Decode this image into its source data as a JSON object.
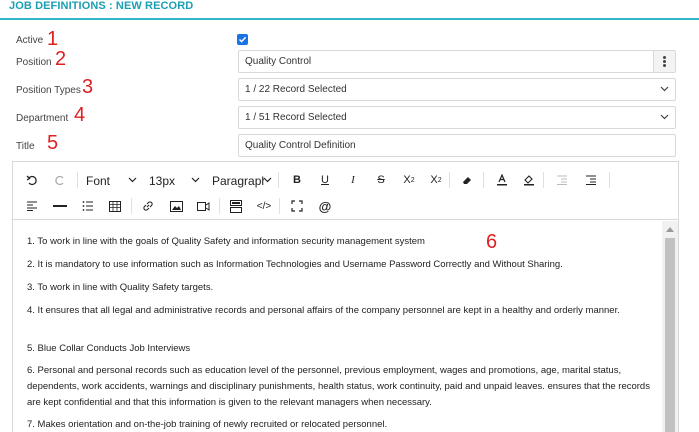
{
  "header": {
    "title": "JOB DEFINITIONS : NEW RECORD"
  },
  "form": {
    "active": {
      "label": "Active",
      "marker": "1",
      "checked": true
    },
    "position": {
      "label": "Position",
      "marker": "2",
      "value": "Quality Control"
    },
    "position_types": {
      "label": "Position Types",
      "marker": "3",
      "value": "1 / 22 Record Selected"
    },
    "department": {
      "label": "Department",
      "marker": "4",
      "value": "1 / 51 Record Selected"
    },
    "title": {
      "label": "Title",
      "marker": "5",
      "value": "Quality Control Definition"
    }
  },
  "editor": {
    "marker": "6",
    "toolbar": {
      "font": "Font",
      "size": "13px",
      "block": "Paragraph",
      "icons": [
        "undo-icon",
        "redo-icon",
        "bold-icon",
        "underline-icon",
        "italic-icon",
        "strikethrough-icon",
        "subscript-icon",
        "superscript-icon",
        "eraser-icon",
        "font-color-icon",
        "highlight-icon",
        "outdent-icon",
        "indent-icon",
        "align-left-icon",
        "horizontal-rule-icon",
        "list-icon",
        "table-icon",
        "link-icon",
        "image-icon",
        "video-icon",
        "template-icon",
        "code-view-icon",
        "fullscreen-icon",
        "mention-icon"
      ]
    },
    "paragraphs": [
      "1. To work in line with the goals of Quality Safety and information security management system",
      "2. It is mandatory to use information such as Information Technologies and Username Password Correctly and Without Sharing.",
      "3. To work in line with Quality Safety targets.",
      "4. It ensures that all legal and administrative records and personal affairs of the company personnel are kept in a healthy and orderly manner.",
      "5. Blue Collar Conducts Job Interviews",
      "6. Personal and personal records such as education level of the personnel, previous employment, wages and promotions, age, marital status, dependents, work accidents, warnings and disciplinary punishments, health status, work continuity, paid and unpaid leaves. ensures that the records are kept confidential and that this information is given to the relevant managers when necessary.",
      "7. Makes orientation and on-the-job training of newly recruited or relocated personnel."
    ]
  },
  "colors": {
    "accent": "#1a9fb3",
    "marker": "#e02020",
    "checkbox": "#1a73e8"
  }
}
